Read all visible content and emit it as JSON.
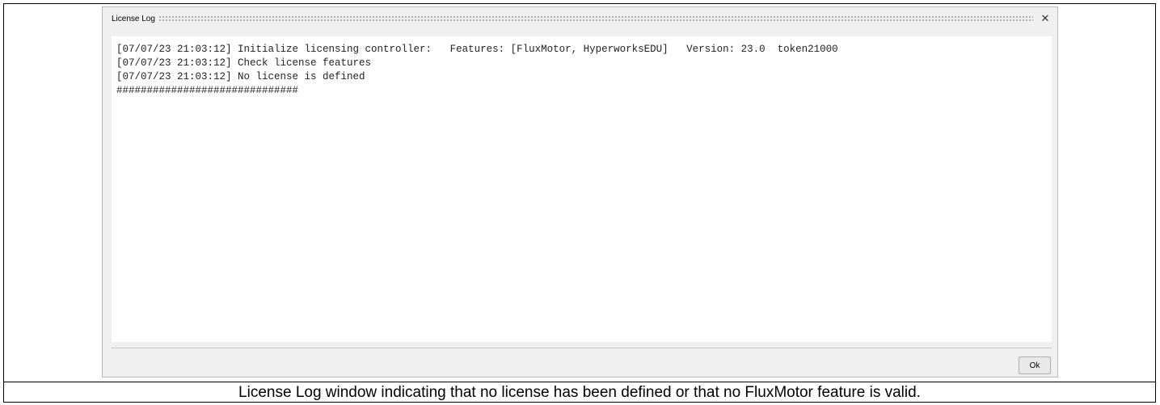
{
  "dialog": {
    "title": "License Log",
    "close_icon": "✕",
    "ok_label": "Ok"
  },
  "log": {
    "lines": [
      "[07/07/23 21:03:12] Initialize licensing controller:   Features: [FluxMotor, HyperworksEDU]   Version: 23.0  token21000",
      "[07/07/23 21:03:12] Check license features",
      "[07/07/23 21:03:12] No license is defined",
      "##############################"
    ]
  },
  "caption": "License Log window indicating that no license has been defined or that no FluxMotor feature is valid."
}
